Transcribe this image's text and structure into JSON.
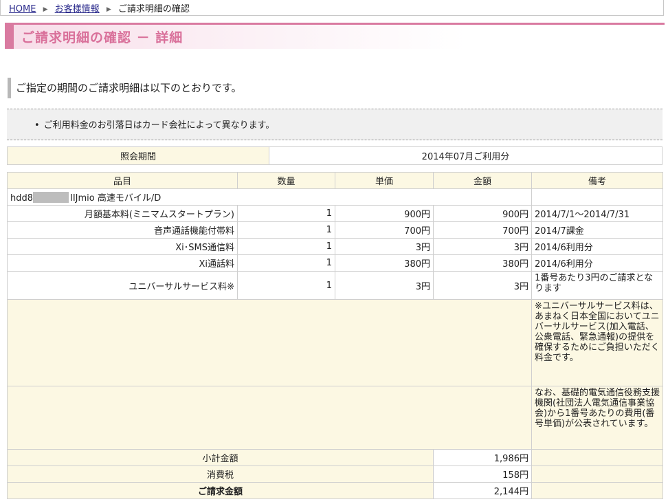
{
  "breadcrumb": {
    "home": "HOME",
    "customer_info": "お客様情報",
    "current": "ご請求明細の確認"
  },
  "page_title": "ご請求明細の確認 － 詳細",
  "lead_text": "ご指定の期間のご請求明細は以下のとおりです。",
  "notice": "ご利用料金のお引落日はカード会社によって異なります。",
  "period": {
    "label": "照会期間",
    "value": "2014年07月ご利用分"
  },
  "columns": {
    "item": "品目",
    "qty": "数量",
    "unit_price": "単価",
    "amount": "金額",
    "remarks": "備考"
  },
  "service_prefix": "hdd8",
  "service_name": "IIJmio 高速モバイル/D",
  "rows": [
    {
      "item": "月額基本料(ミニマムスタートプラン)",
      "qty": "1",
      "unit_price": "900円",
      "amount": "900円",
      "remarks": "2014/7/1～2014/7/31"
    },
    {
      "item": "音声通話機能付帯料",
      "qty": "1",
      "unit_price": "700円",
      "amount": "700円",
      "remarks": "2014/7課金"
    },
    {
      "item": "Xi･SMS通信料",
      "qty": "1",
      "unit_price": "3円",
      "amount": "3円",
      "remarks": "2014/6利用分"
    },
    {
      "item": "Xi通話料",
      "qty": "1",
      "unit_price": "380円",
      "amount": "380円",
      "remarks": "2014/6利用分"
    },
    {
      "item": "ユニバーサルサービス料※",
      "qty": "1",
      "unit_price": "3円",
      "amount": "3円",
      "remarks": "1番号あたり3円のご請求となります"
    }
  ],
  "notes": [
    "※ユニバーサルサービス料は、あまねく日本全国においてユニバーサルサービス(加入電話、公衆電話、緊急通報)の提供を確保するためにご負担いただく料金です。",
    "なお、基礎的電気通信役務支援機関(社団法人電気通信事業協会)から1番号あたりの費用(番号単価)が公表されています。"
  ],
  "totals": {
    "subtotal_label": "小計金額",
    "subtotal_value": "1,986円",
    "tax_label": "消費税",
    "tax_value": "158円",
    "total_label": "ご請求金額",
    "total_value": "2,144円"
  }
}
